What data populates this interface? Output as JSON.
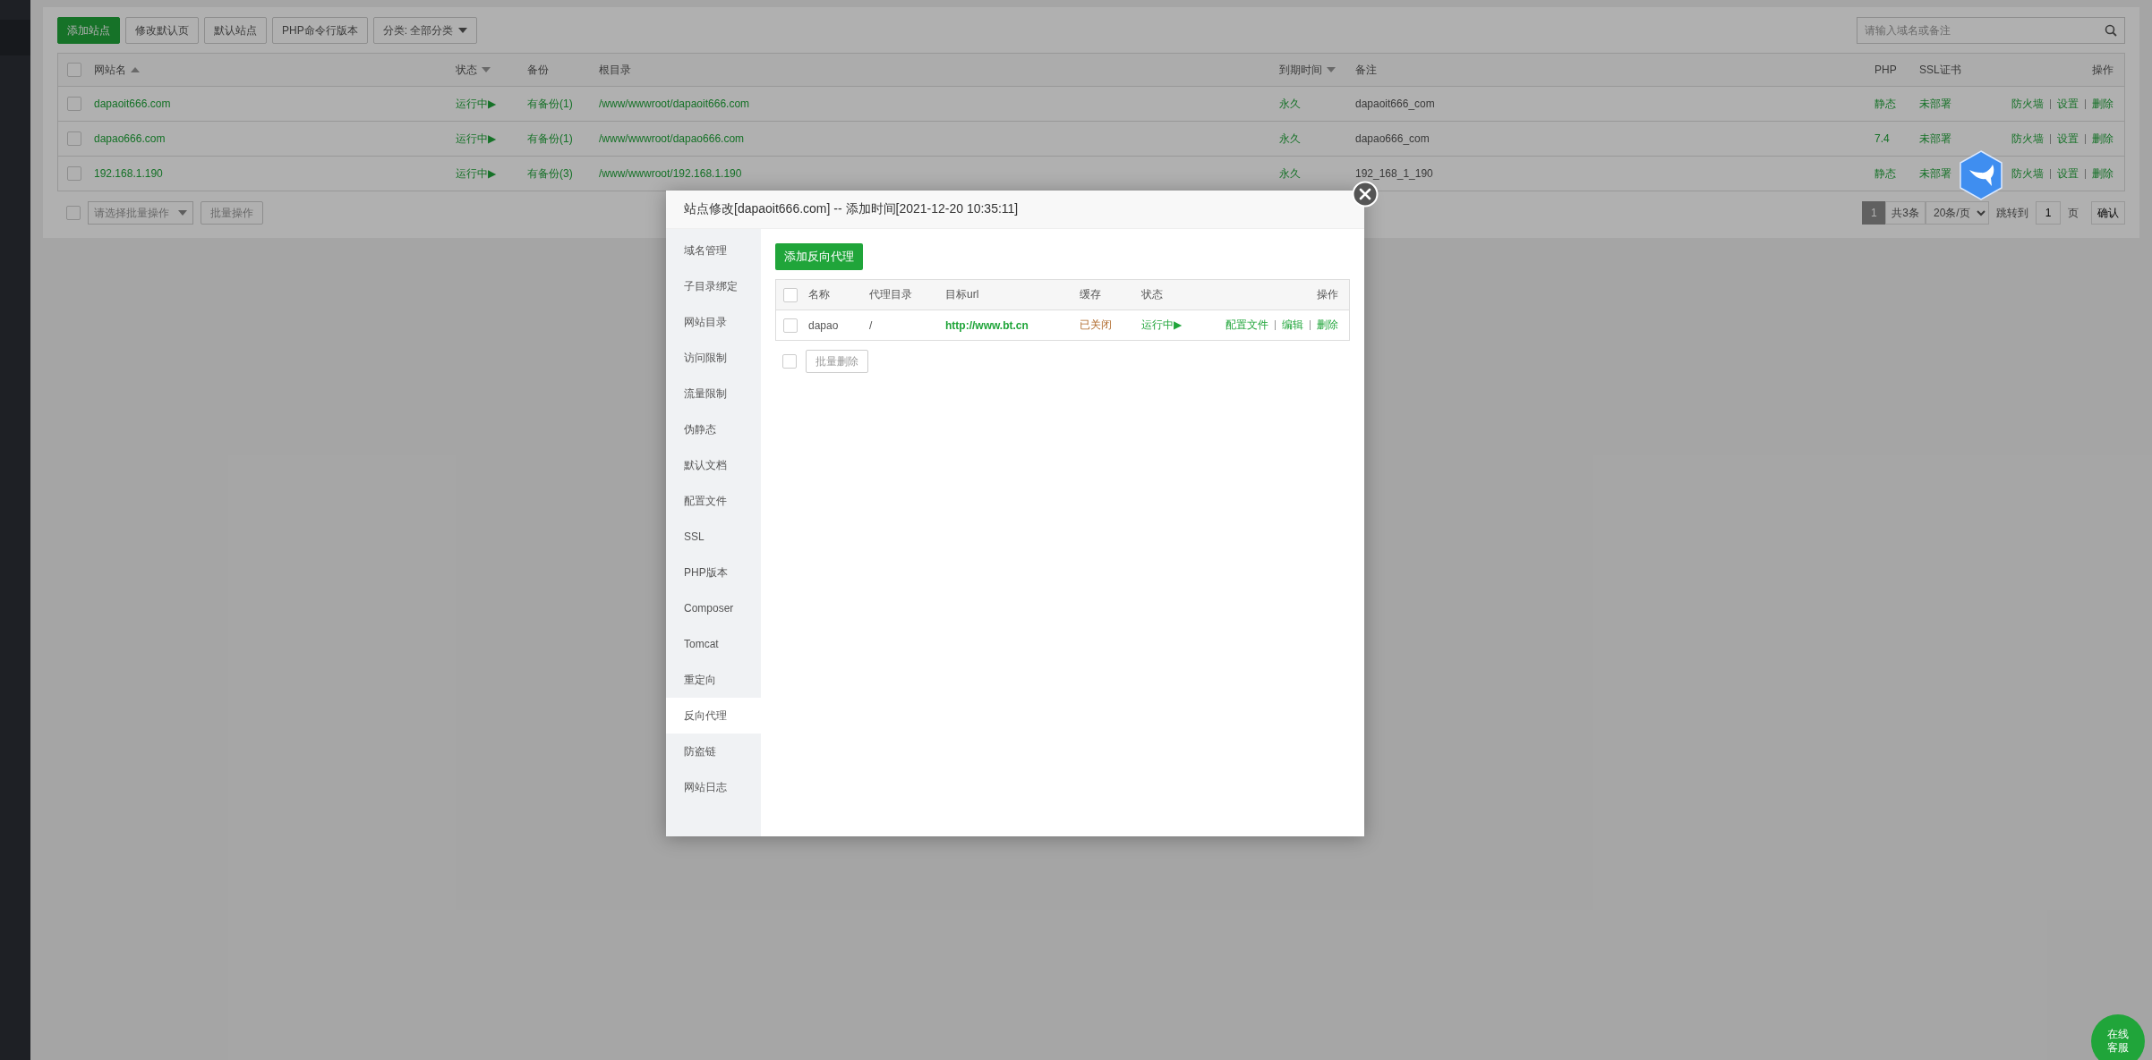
{
  "toolbar": {
    "buttons": [
      {
        "label": "添加站点",
        "kind": "primary"
      },
      {
        "label": "修改默认页",
        "kind": "default"
      },
      {
        "label": "默认站点",
        "kind": "default"
      },
      {
        "label": "PHP命令行版本",
        "kind": "default"
      }
    ],
    "category_dropdown": "分类: 全部分类",
    "search": {
      "placeholder": "请输入域名或备注"
    }
  },
  "sites_table": {
    "all_checked": false,
    "columns": [
      {
        "label": "网站名",
        "sortable": true,
        "sort_ascending": true
      },
      {
        "label": "状态",
        "sortable": true,
        "sort_ascending": false
      },
      {
        "label": "备份"
      },
      {
        "label": "根目录"
      },
      {
        "label": "到期时间",
        "sortable": true,
        "sort_ascending": false
      },
      {
        "label": "备注"
      },
      {
        "label": "PHP"
      },
      {
        "label": "SSL证书"
      },
      {
        "label": "操作"
      }
    ],
    "rows": [
      {
        "checked": false,
        "name": "dapaoit666.com",
        "status": "运行中▶",
        "backup": "有备份(1)",
        "root": "/www/wwwroot/dapaoit666.com",
        "expiry": "永久",
        "note": "dapaoit666_com",
        "php": "静态",
        "ssl": "未部署",
        "actions": [
          "防火墙",
          "设置",
          "删除"
        ]
      },
      {
        "checked": false,
        "name": "dapao666.com",
        "status": "运行中▶",
        "backup": "有备份(1)",
        "root": "/www/wwwroot/dapao666.com",
        "expiry": "永久",
        "note": "dapao666_com",
        "php": "7.4",
        "ssl": "未部署",
        "actions": [
          "防火墙",
          "设置",
          "删除"
        ]
      },
      {
        "checked": false,
        "name": "192.168.1.190",
        "status": "运行中▶",
        "backup": "有备份(3)",
        "root": "/www/wwwroot/192.168.1.190",
        "expiry": "永久",
        "note": "192_168_1_190",
        "php": "静态",
        "ssl": "未部署",
        "actions": [
          "防火墙",
          "设置",
          "删除"
        ]
      }
    ]
  },
  "batch": {
    "checked": false,
    "select_placeholder": "请选择批量操作",
    "button": "批量操作"
  },
  "pagination": {
    "pages": [
      {
        "label": "1",
        "selected": true
      }
    ],
    "total": "共3条",
    "per_page": "20条/页",
    "jump_label": "跳转到",
    "page_input": "1",
    "page_unit": "页",
    "confirm": "确认"
  },
  "modal": {
    "title": "站点修改[dapaoit666.com] -- 添加时间[2021-12-20 10:35:11]",
    "menu": [
      {
        "label": "域名管理",
        "selected": false
      },
      {
        "label": "子目录绑定",
        "selected": false
      },
      {
        "label": "网站目录",
        "selected": false
      },
      {
        "label": "访问限制",
        "selected": false
      },
      {
        "label": "流量限制",
        "selected": false
      },
      {
        "label": "伪静态",
        "selected": false
      },
      {
        "label": "默认文档",
        "selected": false
      },
      {
        "label": "配置文件",
        "selected": false
      },
      {
        "label": "SSL",
        "selected": false
      },
      {
        "label": "PHP版本",
        "selected": false
      },
      {
        "label": "Composer",
        "selected": false
      },
      {
        "label": "Tomcat",
        "selected": false
      },
      {
        "label": "重定向",
        "selected": false
      },
      {
        "label": "反向代理",
        "selected": true
      },
      {
        "label": "防盗链",
        "selected": false
      },
      {
        "label": "网站日志",
        "selected": false
      }
    ],
    "add_button": "添加反向代理",
    "proxy_table": {
      "all_checked": false,
      "columns": [
        "名称",
        "代理目录",
        "目标url",
        "缓存",
        "状态",
        "操作"
      ],
      "rows": [
        {
          "checked": false,
          "name": "dapao",
          "directory": "/",
          "target_url": "http://www.bt.cn",
          "cache": "已关闭",
          "status": "运行中▶",
          "actions": [
            "配置文件",
            "编辑",
            "删除"
          ]
        }
      ]
    },
    "batch_checked": false,
    "batch_delete_button": "批量删除"
  },
  "chat_button": [
    "在线",
    "客服"
  ]
}
